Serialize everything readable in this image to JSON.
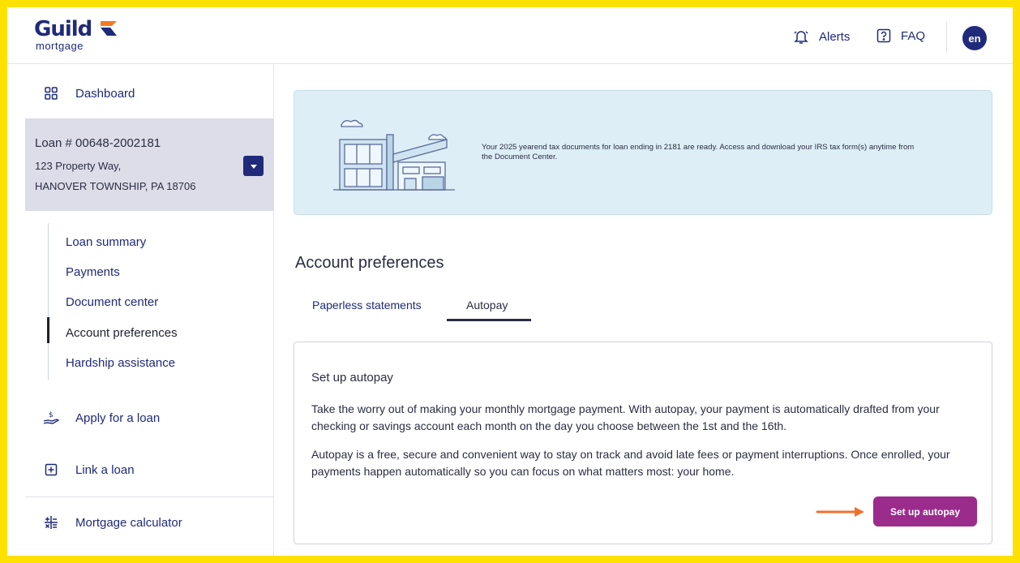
{
  "brand": {
    "name": "Guild",
    "sub": "mortgage",
    "accent": "#f47b20",
    "primary": "#1f2a7a"
  },
  "header": {
    "alerts_label": "Alerts",
    "faq_label": "FAQ",
    "avatar_text": "en"
  },
  "sidebar": {
    "dashboard": "Dashboard",
    "loan": {
      "number": "Loan # 00648-2002181",
      "address1": "123 Property Way,",
      "address2": "HANOVER TOWNSHIP, PA 18706"
    },
    "sub_items": [
      {
        "label": "Loan summary"
      },
      {
        "label": "Payments"
      },
      {
        "label": "Document center"
      },
      {
        "label": "Account preferences",
        "active": true
      },
      {
        "label": "Hardship assistance"
      }
    ],
    "apply": "Apply for a loan",
    "link": "Link a loan",
    "calculator": "Mortgage calculator"
  },
  "banner": {
    "text": "Your 2025 yearend tax documents for loan ending in 2181 are ready. Access and download your IRS tax form(s) anytime from the Document Center."
  },
  "main": {
    "title": "Account preferences",
    "tabs": [
      {
        "label": "Paperless statements"
      },
      {
        "label": "Autopay",
        "active": true
      }
    ],
    "card": {
      "title": "Set up autopay",
      "p1": "Take the worry out of making your monthly mortgage payment. With autopay, your payment is automatically drafted from your checking or savings account each month on the day you choose between the 1st and the 16th.",
      "p2": "Autopay is a free, secure and convenient way to stay on track and avoid late fees or payment interruptions. Once enrolled, your payments happen automatically so you can focus on what matters most: your home.",
      "button": "Set up autopay"
    }
  },
  "colors": {
    "frame": "#ffe100",
    "button": "#9b2c8c",
    "arrow": "#f0712e",
    "banner_bg": "#ddeef6"
  }
}
